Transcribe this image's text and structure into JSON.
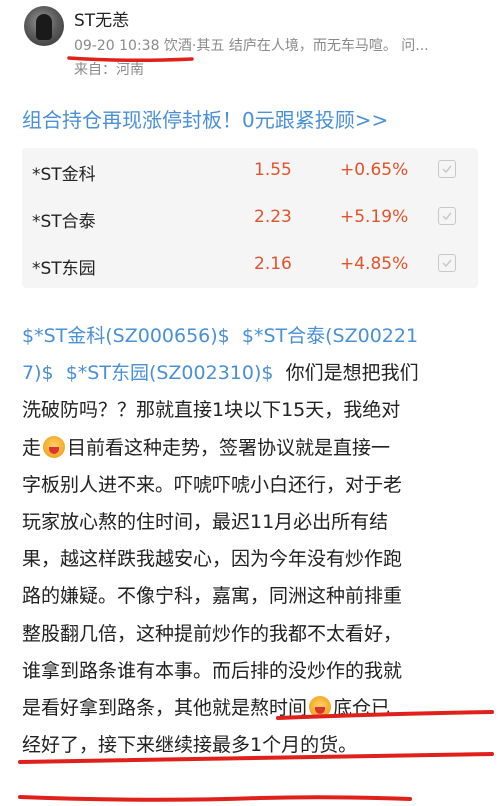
{
  "post": {
    "username": "ST无恙",
    "meta": "09-20 10:38 饮酒·其五 结庐在人境，而无车马喧。 问...",
    "location": "来自：河南",
    "headline": "组合持仓再现涨停封板！0元跟紧投顾>>"
  },
  "holdings": [
    {
      "name": "*ST金科",
      "price": "1.55",
      "change": "+0.65%"
    },
    {
      "name": "*ST合泰",
      "price": "2.23",
      "change": "+5.19%"
    },
    {
      "name": "*ST东园",
      "price": "2.16",
      "change": "+4.85%"
    }
  ],
  "body": {
    "l1_tag1": "$*ST金科(SZ000656)$",
    "l1_tag2": "$*ST合泰(SZ00221",
    "l2_tag2b": "7)$",
    "l2_tag3": "$*ST东园(SZ002310)$",
    "l2_text": "你们是想把我们",
    "l3": "洗破防吗？？那就直接1块以下15天，我绝对",
    "l4a": "走",
    "l4b": "目前看这种走势，签署协议就是直接一",
    "l5": "字板别人进不来。吓唬吓唬小白还行，对于老",
    "l6": "玩家放心熬的住时间，最迟11月必出所有结",
    "l7": "果，越这样跌我越安心，因为今年没有炒作跑",
    "l8": "路的嫌疑。不像宁科，嘉寓，同洲这种前排重",
    "l9": "整股翻几倍，这种提前炒作的我都不太看好，",
    "l10": "谁拿到路条谁有本事。而后排的没炒作的我就",
    "l11a": "是看好拿到路条，其他就是熬时间",
    "l11b": "底仓已",
    "l12": "经好了，接下来继续接最多1个月的货。"
  },
  "colors": {
    "link": "#4a90d6",
    "up": "#e0532b",
    "annotation": "#e0201a"
  },
  "icons": {
    "check": "checkmark-icon",
    "emoji": "grinning-emoji-icon"
  }
}
